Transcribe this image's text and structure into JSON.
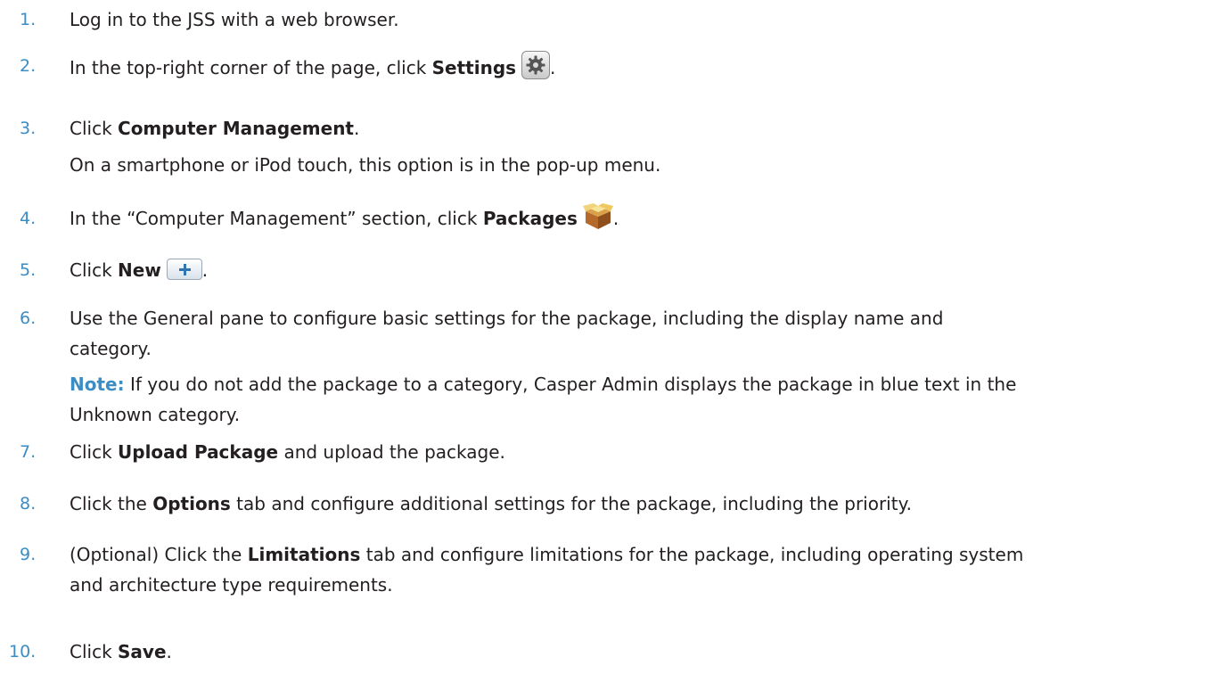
{
  "steps": [
    {
      "number": "1.",
      "text": "Log in to the JSS with a web browser."
    },
    {
      "number": "2.",
      "pre": "In the top-right corner of the page, click ",
      "bold": "Settings",
      "icon": "gear-icon",
      "post": "."
    },
    {
      "number": "3.",
      "pre": "Click ",
      "bold": "Computer Management",
      "post": ".",
      "sub": "On a smartphone or iPod touch, this option is in the pop-up menu."
    },
    {
      "number": "4.",
      "pre": "In the “Computer Management” section, click ",
      "bold": "Packages",
      "icon": "package-icon",
      "post": "."
    },
    {
      "number": "5.",
      "pre": "Click ",
      "bold": "New",
      "icon": "plus-icon",
      "post": "."
    },
    {
      "number": "6.",
      "line1": "Use the General pane to configure basic settings for the package, including the display name and",
      "line2": "category.",
      "note_label": "Note:",
      "note_line1": " If you do not add the package to a category, Casper Admin displays the package in blue text in the",
      "note_line2": "Unknown category."
    },
    {
      "number": "7.",
      "pre": "Click ",
      "bold": "Upload Package",
      "post": " and upload the package."
    },
    {
      "number": "8.",
      "pre": "Click the ",
      "bold": "Options",
      "post": " tab and configure additional settings for the package, including the priority."
    },
    {
      "number": "9.",
      "pre": "(Optional) Click the ",
      "bold": "Limitations",
      "post": " tab and configure limitations for the package, including operating system",
      "line2": "and architecture type requirements."
    },
    {
      "number": "10.",
      "pre": "Click ",
      "bold": "Save",
      "post": "."
    }
  ],
  "colors": {
    "number": "#3c8dc4",
    "note_label": "#3c8dc4",
    "text": "#231f20"
  }
}
